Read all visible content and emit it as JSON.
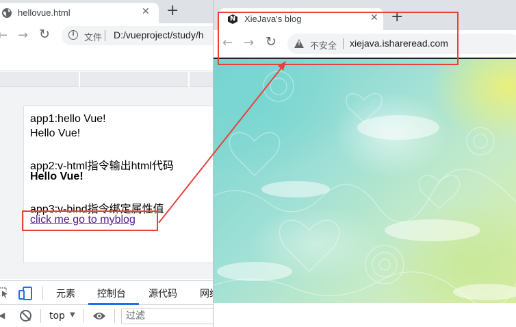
{
  "left_browser": {
    "tab": {
      "title": "hellovue.html",
      "favicon": "globe-icon",
      "close_icon": "close-icon"
    },
    "new_tab_icon": "plus-icon",
    "toolbar": {
      "back_icon": "arrow-left-icon",
      "forward_icon": "arrow-right-icon",
      "reload_icon": "reload-icon",
      "info_icon": "info-icon",
      "file_label": "文件",
      "url": "D:/vueproject/study/h"
    },
    "page": {
      "app1_label": "app1:hello Vue!",
      "app1_output": "Hello Vue!",
      "app2_label": "app2:v-html指令输出html代码",
      "app2_output": "Hello Vue!",
      "app3_label": "app3:v-bind指令绑定属性值",
      "app3_link": "click me go to myblog"
    },
    "devtools": {
      "tabs": [
        "元素",
        "控制台",
        "源代码",
        "网络"
      ],
      "active_tab": "控制台",
      "context": "top",
      "filter_placeholder": "过滤"
    }
  },
  "right_browser": {
    "tab": {
      "title": "XieJava's blog",
      "favicon": "nginx-n-icon",
      "close_icon": "close-icon"
    },
    "new_tab_icon": "plus-icon",
    "toolbar": {
      "back_icon": "arrow-left-icon",
      "forward_icon": "arrow-right-icon",
      "reload_icon": "reload-icon",
      "security_icon": "warning-triangle-icon",
      "security_label": "不安全",
      "url": "xiejava.ishareread.com"
    }
  },
  "colors": {
    "annotation_red": "#e8413b",
    "link_visited": "#551a8b",
    "devtools_accent": "#1a73e8",
    "tabstrip_bg": "#dee1e6"
  }
}
